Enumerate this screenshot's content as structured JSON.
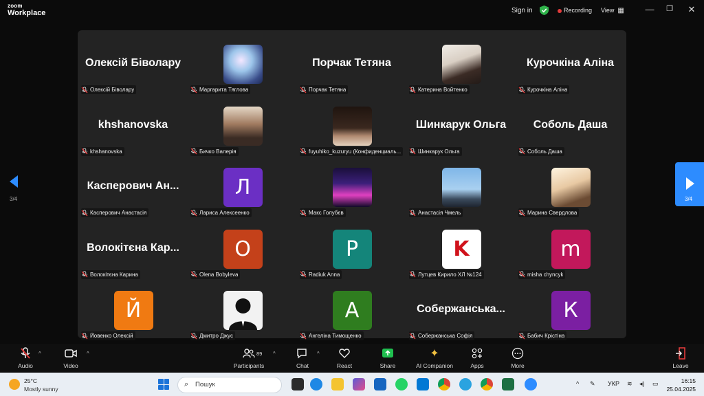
{
  "window": {
    "logo_line1": "zoom",
    "logo_line2": "Workplace",
    "sign_in": "Sign in",
    "recording": "Recording",
    "view": "View"
  },
  "gallery": {
    "page_indicator": "3/4",
    "tiles": [
      {
        "big_name": "Олексій Біволару",
        "label": "Олексій Біволару"
      },
      {
        "avatar": "photo-blue",
        "label": "Маргарита Тяглова"
      },
      {
        "big_name": "Порчак Тетяна",
        "label": "Порчак Тетяна"
      },
      {
        "avatar": "photo-girl",
        "label": "Катерина Войтенко"
      },
      {
        "big_name": "Курочкіна Аліна",
        "label": "Курочкіна Аліна"
      },
      {
        "big_name": "khshanovska",
        "label": "khshanovska"
      },
      {
        "avatar": "photo-girl2",
        "label": "Бичко Валерія"
      },
      {
        "avatar": "photo-hair",
        "label": "fuyuhiko_kuzuryu (Конфиденциаль..."
      },
      {
        "big_name": "Шинкарук Ольга",
        "label": "Шинкарук Ольга"
      },
      {
        "big_name": "Соболь Даша",
        "label": "Соболь Даша"
      },
      {
        "big_name": "Касперович  Ан...",
        "label": "Касперович Анастасія"
      },
      {
        "letter": "Л",
        "color": "#6b2fc4",
        "label": "Лариса Алексеенко"
      },
      {
        "avatar": "photo-neon",
        "label": "Макс Голубєв"
      },
      {
        "avatar": "photo-sky",
        "label": "Анастасія Чмель"
      },
      {
        "avatar": "photo-anime",
        "label": "Марина Свердлова"
      },
      {
        "big_name": "Волокітєна  Кар...",
        "label": "Волокітєна Карина"
      },
      {
        "letter": "O",
        "color": "#c4411a",
        "label": "Olena Bobyleva"
      },
      {
        "letter": "P",
        "color": "#14857a",
        "label": "Radiuk Anna"
      },
      {
        "letter": "K",
        "color": "#ffffff",
        "letter_color": "#d0121b",
        "label": "Лутцев Кирило ХЛ №124"
      },
      {
        "letter": "m",
        "color": "#c2185b",
        "label": "misha chyncyk"
      },
      {
        "letter": "Й",
        "color": "#f07a12",
        "label": "Йовенко Олексій"
      },
      {
        "avatar": "photo-silhouette",
        "label": "Дмитро Джус"
      },
      {
        "letter": "А",
        "color": "#2f7d1f",
        "label": "Ангеліна Тимощенко"
      },
      {
        "big_name": "Собержанська...",
        "label": "Собержанська Софія"
      },
      {
        "letter": "К",
        "color": "#7b1fa2",
        "label": "Бабич Крістіна"
      }
    ]
  },
  "toolbar": {
    "audio": "Audio",
    "video": "Video",
    "participants": "Participants",
    "participants_count": "89",
    "chat": "Chat",
    "react": "React",
    "share": "Share",
    "ai": "AI Companion",
    "apps": "Apps",
    "more": "More",
    "leave": "Leave"
  },
  "taskbar": {
    "temp": "25°C",
    "weather": "Mostly sunny",
    "search_placeholder": "Пошук",
    "lang": "УКР",
    "time": "16:15",
    "date": "25.04.2025"
  }
}
